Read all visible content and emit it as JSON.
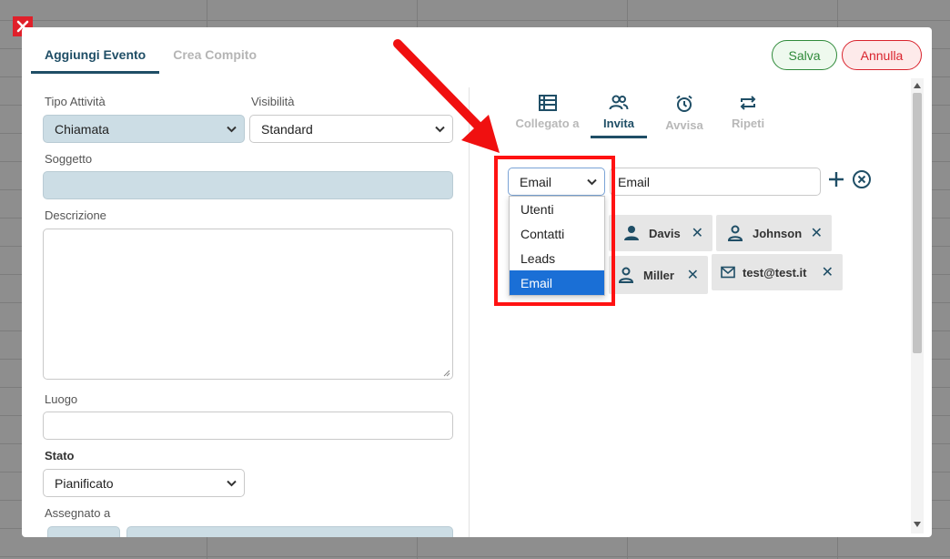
{
  "tabs": [
    {
      "label": "Aggiungi Evento",
      "active": true
    },
    {
      "label": "Crea Compito",
      "active": false
    }
  ],
  "actions": {
    "save_label": "Salva",
    "cancel_label": "Annulla"
  },
  "form": {
    "tipo_attivita": {
      "label": "Tipo Attività",
      "value": "Chiamata"
    },
    "visibilita": {
      "label": "Visibilità",
      "value": "Standard"
    },
    "soggetto": {
      "label": "Soggetto",
      "value": ""
    },
    "descrizione": {
      "label": "Descrizione",
      "value": ""
    },
    "luogo": {
      "label": "Luogo",
      "value": ""
    },
    "stato": {
      "label": "Stato",
      "value": "Pianificato"
    },
    "assegnato": {
      "label": "Assegnato a"
    }
  },
  "right_tabs": [
    {
      "label": "Collegato a",
      "icon": "list-icon",
      "active": false
    },
    {
      "label": "Invita",
      "icon": "people-icon",
      "active": true
    },
    {
      "label": "Avvisa",
      "icon": "alarm-icon",
      "active": false
    },
    {
      "label": "Ripeti",
      "icon": "repeat-icon",
      "active": false
    }
  ],
  "invite": {
    "type_select_value": "Email",
    "email_input_value": "Email",
    "dropdown_options": [
      "Utenti",
      "Contatti",
      "Leads",
      "Email"
    ],
    "dropdown_selected": "Email"
  },
  "chips": [
    {
      "label": "Davis",
      "icon": "person-filled-icon"
    },
    {
      "label": "Johnson",
      "icon": "person-outline-icon"
    },
    {
      "label": "Miller",
      "icon": "person-outline-icon"
    },
    {
      "label": "test@test.it",
      "icon": "mail-icon"
    }
  ],
  "colors": {
    "accent": "#1f4e66",
    "save": "#2f8a3a",
    "cancel": "#d9232d",
    "selected_option": "#1a6fd6",
    "highlight_box": "#ff1212"
  }
}
